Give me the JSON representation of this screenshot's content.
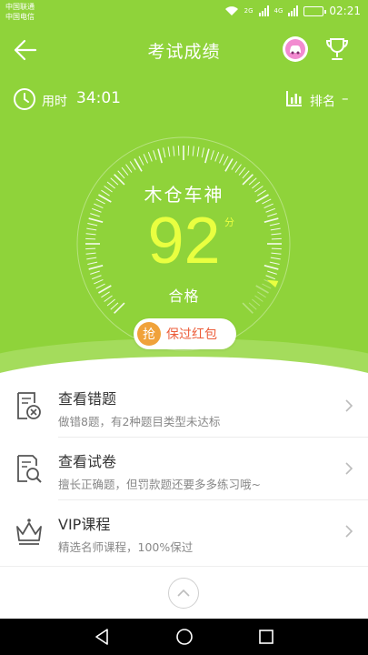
{
  "status_bar": {
    "carrier_1": "中国联通",
    "carrier_2": "中国电信",
    "net_1": "2G",
    "net_2": "4G",
    "time": "02:21",
    "battery_level": 1.0
  },
  "header": {
    "title": "考试成绩",
    "back_icon": "arrow-left-icon",
    "avatar_icon": "car-avatar-icon",
    "trophy_icon": "trophy-icon"
  },
  "stats": {
    "time_label": "用时",
    "time_value": "34:01",
    "rank_label": "排名",
    "rank_value": "–"
  },
  "result": {
    "rank_title": "木仓车神",
    "score": "92",
    "unit": "分",
    "status": "合格",
    "score_fraction": 0.92
  },
  "red_packet": {
    "badge": "抢",
    "label": "保过红包"
  },
  "menu": [
    {
      "title": "查看错题",
      "subtitle": "做错8题，有2种题目类型未达标",
      "icon": "wrong-answers-icon"
    },
    {
      "title": "查看试卷",
      "subtitle": "擅长正确题，但罚款题还要多多练习哦~",
      "icon": "exam-paper-search-icon"
    },
    {
      "title": "VIP课程",
      "subtitle": "精选名师课程，100%保过",
      "icon": "crown-icon"
    }
  ],
  "colors": {
    "hero_green": "#8fd33a",
    "score_yellow": "#e9ff40",
    "red_packet_text": "#ec5d3a",
    "badge_orange": "#f0a23a"
  }
}
